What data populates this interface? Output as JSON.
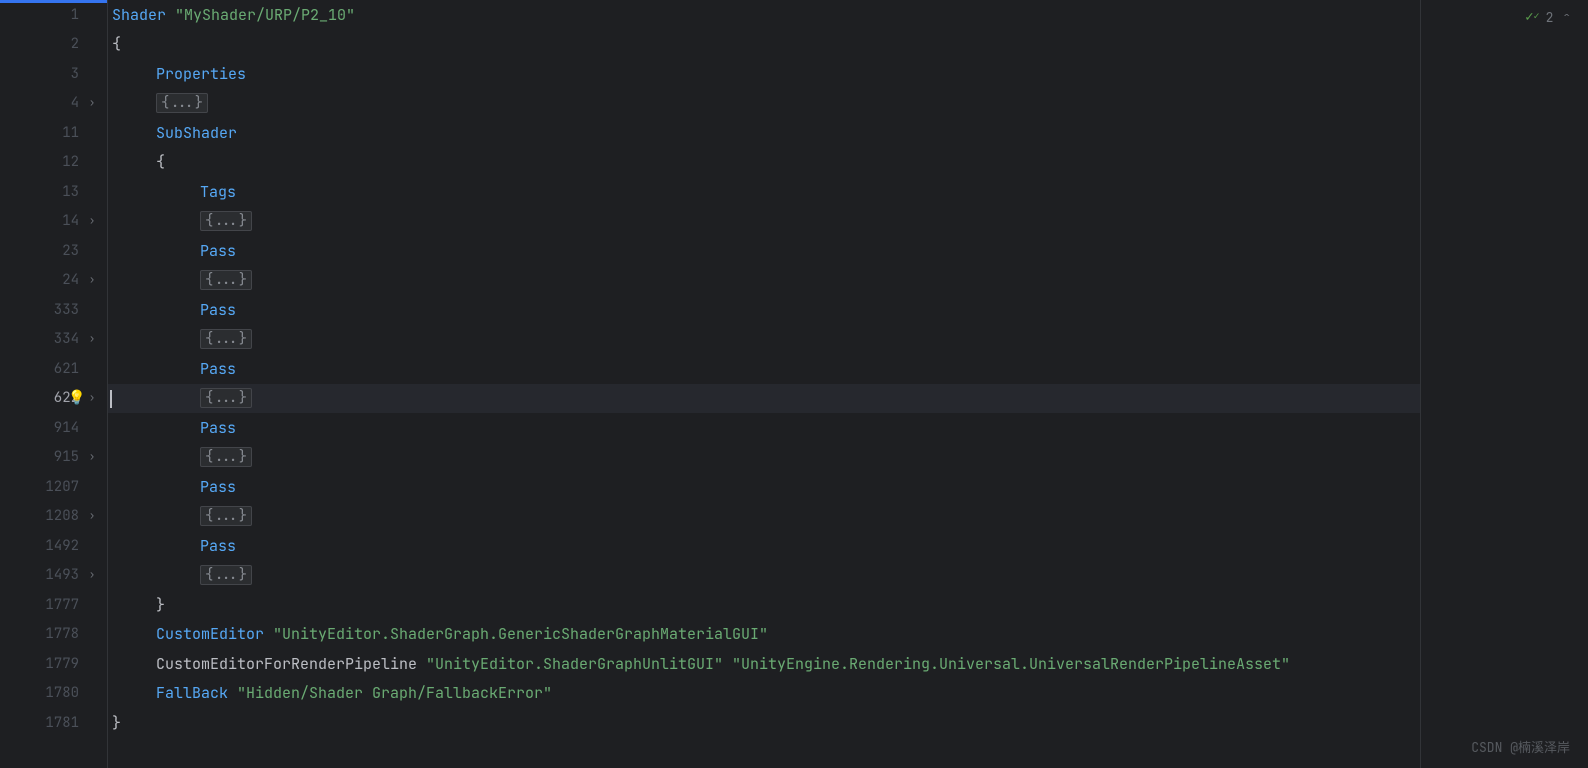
{
  "inspection": {
    "count": "2"
  },
  "watermark": "CSDN @楠溪泽岸",
  "folded_text": "{...}",
  "lines": [
    {
      "num": "1",
      "fold": "",
      "indent": 0,
      "segs": [
        {
          "t": "Shader ",
          "c": "keyword"
        },
        {
          "t": "\"MyShader/URP/P2_10\"",
          "c": "string"
        }
      ]
    },
    {
      "num": "2",
      "fold": "",
      "indent": 0,
      "segs": [
        {
          "t": "{",
          "c": "brace"
        }
      ]
    },
    {
      "num": "3",
      "fold": "",
      "indent": 1,
      "segs": [
        {
          "t": "Properties",
          "c": "keyword"
        }
      ]
    },
    {
      "num": "4",
      "fold": "right",
      "indent": 1,
      "segs": [
        {
          "t": "",
          "c": "folded"
        }
      ]
    },
    {
      "num": "11",
      "fold": "",
      "indent": 1,
      "segs": [
        {
          "t": "SubShader",
          "c": "keyword"
        }
      ]
    },
    {
      "num": "12",
      "fold": "",
      "indent": 1,
      "segs": [
        {
          "t": "{",
          "c": "brace"
        }
      ]
    },
    {
      "num": "13",
      "fold": "",
      "indent": 2,
      "segs": [
        {
          "t": "Tags",
          "c": "keyword"
        }
      ]
    },
    {
      "num": "14",
      "fold": "right",
      "indent": 2,
      "segs": [
        {
          "t": "",
          "c": "folded"
        }
      ]
    },
    {
      "num": "23",
      "fold": "",
      "indent": 2,
      "segs": [
        {
          "t": "Pass",
          "c": "keyword"
        }
      ]
    },
    {
      "num": "24",
      "fold": "right",
      "indent": 2,
      "segs": [
        {
          "t": "",
          "c": "folded"
        }
      ]
    },
    {
      "num": "333",
      "fold": "",
      "indent": 2,
      "segs": [
        {
          "t": "Pass",
          "c": "keyword"
        }
      ]
    },
    {
      "num": "334",
      "fold": "right",
      "indent": 2,
      "segs": [
        {
          "t": "",
          "c": "folded"
        }
      ]
    },
    {
      "num": "621",
      "fold": "",
      "indent": 2,
      "segs": [
        {
          "t": "Pass",
          "c": "keyword"
        }
      ]
    },
    {
      "num": "622",
      "fold": "right",
      "indent": 2,
      "segs": [
        {
          "t": "",
          "c": "folded"
        }
      ],
      "active": true,
      "bulb": true,
      "highlight": true
    },
    {
      "num": "914",
      "fold": "",
      "indent": 2,
      "segs": [
        {
          "t": "Pass",
          "c": "keyword"
        }
      ]
    },
    {
      "num": "915",
      "fold": "right",
      "indent": 2,
      "segs": [
        {
          "t": "",
          "c": "folded"
        }
      ]
    },
    {
      "num": "1207",
      "fold": "",
      "indent": 2,
      "segs": [
        {
          "t": "Pass",
          "c": "keyword"
        }
      ]
    },
    {
      "num": "1208",
      "fold": "right",
      "indent": 2,
      "segs": [
        {
          "t": "",
          "c": "folded"
        }
      ]
    },
    {
      "num": "1492",
      "fold": "",
      "indent": 2,
      "segs": [
        {
          "t": "Pass",
          "c": "keyword"
        }
      ]
    },
    {
      "num": "1493",
      "fold": "right",
      "indent": 2,
      "segs": [
        {
          "t": "",
          "c": "folded"
        }
      ]
    },
    {
      "num": "1777",
      "fold": "",
      "indent": 1,
      "segs": [
        {
          "t": "}",
          "c": "brace"
        }
      ]
    },
    {
      "num": "1778",
      "fold": "",
      "indent": 1,
      "segs": [
        {
          "t": "CustomEditor ",
          "c": "keyword"
        },
        {
          "t": "\"UnityEditor.ShaderGraph.GenericShaderGraphMaterialGUI\"",
          "c": "string"
        }
      ]
    },
    {
      "num": "1779",
      "fold": "",
      "indent": 1,
      "segs": [
        {
          "t": "CustomEditorForRenderPipeline ",
          "c": "ident"
        },
        {
          "t": "\"UnityEditor.ShaderGraphUnlitGUI\" \"UnityEngine.Rendering.Universal.UniversalRenderPipelineAsset\"",
          "c": "string"
        }
      ]
    },
    {
      "num": "1780",
      "fold": "",
      "indent": 1,
      "segs": [
        {
          "t": "FallBack ",
          "c": "keyword"
        },
        {
          "t": "\"Hidden/Shader Graph/FallbackError\"",
          "c": "string"
        }
      ]
    },
    {
      "num": "1781",
      "fold": "",
      "indent": 0,
      "segs": [
        {
          "t": "}",
          "c": "brace"
        }
      ]
    }
  ]
}
